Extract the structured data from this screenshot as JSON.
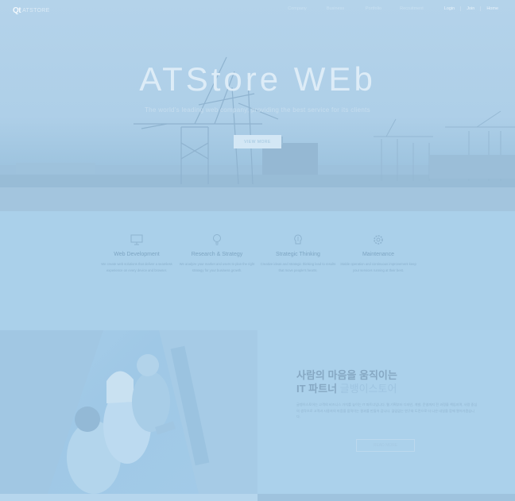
{
  "header": {
    "logo_mark": "Qt",
    "logo_text": "ATSTORE",
    "nav": [
      "Company",
      "Business",
      "Portfolio",
      "Recruitment"
    ],
    "util": [
      "Login",
      "Join",
      "Home"
    ]
  },
  "hero": {
    "title": "ATStore WEb",
    "subtitle": "The world's leading web company, providing the best service for its clients",
    "button": "VIEW MORE"
  },
  "services": [
    {
      "icon": "monitor-icon",
      "title": "Web Development",
      "desc": "We create web solutions that deliver a seamless experience on every device and browser."
    },
    {
      "icon": "lightbulb-icon",
      "title": "Research & Strategy",
      "desc": "We analyze your market and users to plan the right strategy for your business growth."
    },
    {
      "icon": "brain-icon",
      "title": "Strategic Thinking",
      "desc": "Creative ideas and strategic thinking lead to results that move people's hearts."
    },
    {
      "icon": "gear-icon",
      "title": "Maintenance",
      "desc": "Stable operation and continuous improvement keep your services running at their best."
    }
  ],
  "about": {
    "heading_line1": "사람의 마음을 움직이는",
    "heading_line2_prefix": "IT 파트너",
    "heading_line2_highlight": "글뱅이스토어",
    "body": "글뱅이스토어는 고객의 비즈니스 가치를 높이는 IT 파트너입니다. 웹 기획부터 디자인, 개발, 운영까지 전 과정을 책임지며, 사람 중심의 생각으로 고객과 사용자의 마음을 움직이는 결과를 만들어 갑니다. 끊임없는 연구와 도전으로 더 나은 내일을 함께 열어가겠습니다.",
    "button": "READ MORE"
  },
  "colors": {
    "overlay": "#a9d0ea",
    "heading": "#86a8c3",
    "highlight": "#9ec4e0"
  }
}
